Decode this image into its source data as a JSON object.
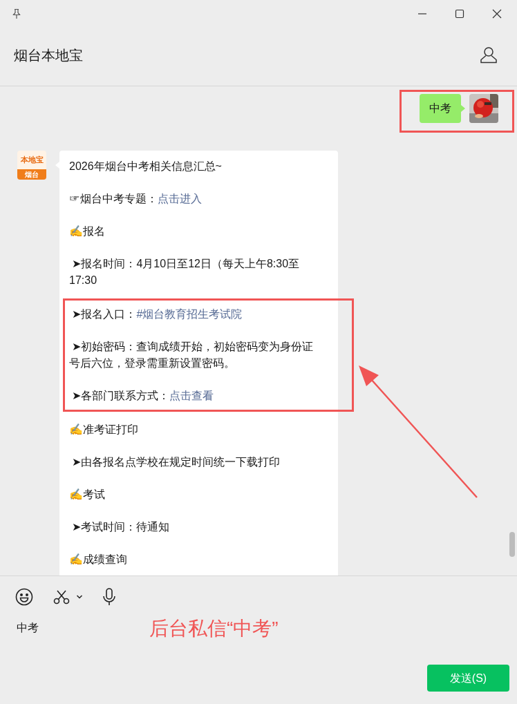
{
  "window": {
    "title": "烟台本地宝"
  },
  "messages": [
    {
      "kind": "outgoing",
      "text": "中考",
      "highlighted": true
    },
    {
      "kind": "incoming",
      "logo": {
        "top": "本地宝",
        "bottom": "烟台"
      },
      "paragraphs": [
        {
          "text": "2026年烟台中考相关信息汇总~",
          "highlighted": false
        },
        {
          "text": "☞烟台中考专题：",
          "link": "点击进入",
          "highlighted": false
        },
        {
          "text": "✍报名",
          "highlighted": false
        },
        {
          "text": " ➤报名时间：4月10日至12日（每天上午8:30至17:30",
          "highlighted": false
        },
        {
          "text": " ➤报名入口：",
          "link": "#烟台教育招生考试院",
          "highlighted": true
        },
        {
          "text": " ➤初始密码：查询成绩开始，初始密码变为身份证号后六位，登录需重新设置密码。",
          "highlighted": true
        },
        {
          "text": " ➤各部门联系方式：",
          "link": "点击查看",
          "highlighted": true
        },
        {
          "text": "✍准考证打印",
          "highlighted": false
        },
        {
          "text": " ➤由各报名点学校在规定时间统一下载打印",
          "highlighted": false
        },
        {
          "text": "✍考试",
          "highlighted": false
        },
        {
          "text": " ➤考试时间：待通知",
          "highlighted": false
        },
        {
          "text": "✍成绩查询",
          "highlighted": false
        }
      ]
    }
  ],
  "annotation_text": "后台私信“中考”",
  "input": {
    "value": "中考"
  },
  "send_button": "发送(S)"
}
